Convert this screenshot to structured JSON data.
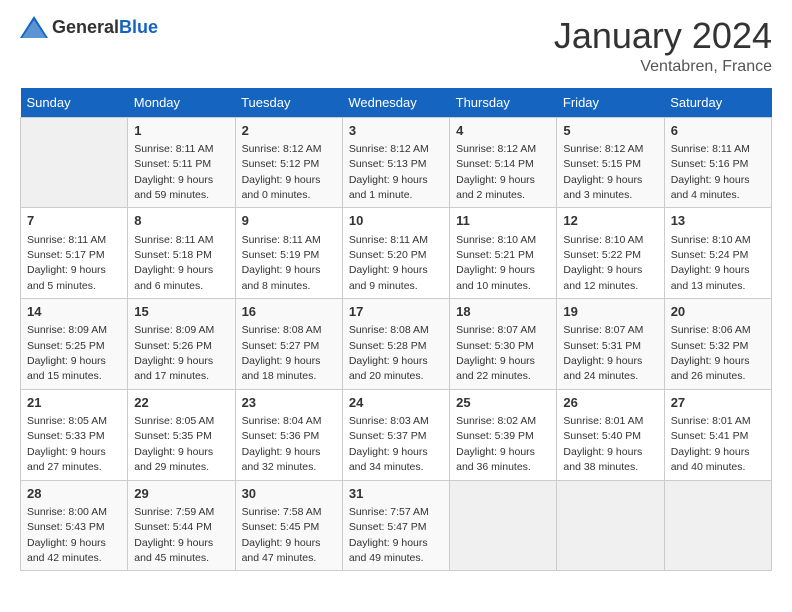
{
  "header": {
    "logo_general": "General",
    "logo_blue": "Blue",
    "title": "January 2024",
    "subtitle": "Ventabren, France"
  },
  "calendar": {
    "weekdays": [
      "Sunday",
      "Monday",
      "Tuesday",
      "Wednesday",
      "Thursday",
      "Friday",
      "Saturday"
    ],
    "weeks": [
      [
        {
          "day": "",
          "empty": true
        },
        {
          "day": "1",
          "sunrise": "Sunrise: 8:11 AM",
          "sunset": "Sunset: 5:11 PM",
          "daylight": "Daylight: 9 hours and 59 minutes."
        },
        {
          "day": "2",
          "sunrise": "Sunrise: 8:12 AM",
          "sunset": "Sunset: 5:12 PM",
          "daylight": "Daylight: 9 hours and 0 minutes."
        },
        {
          "day": "3",
          "sunrise": "Sunrise: 8:12 AM",
          "sunset": "Sunset: 5:13 PM",
          "daylight": "Daylight: 9 hours and 1 minute."
        },
        {
          "day": "4",
          "sunrise": "Sunrise: 8:12 AM",
          "sunset": "Sunset: 5:14 PM",
          "daylight": "Daylight: 9 hours and 2 minutes."
        },
        {
          "day": "5",
          "sunrise": "Sunrise: 8:12 AM",
          "sunset": "Sunset: 5:15 PM",
          "daylight": "Daylight: 9 hours and 3 minutes."
        },
        {
          "day": "6",
          "sunrise": "Sunrise: 8:11 AM",
          "sunset": "Sunset: 5:16 PM",
          "daylight": "Daylight: 9 hours and 4 minutes."
        }
      ],
      [
        {
          "day": "7",
          "sunrise": "Sunrise: 8:11 AM",
          "sunset": "Sunset: 5:17 PM",
          "daylight": "Daylight: 9 hours and 5 minutes."
        },
        {
          "day": "8",
          "sunrise": "Sunrise: 8:11 AM",
          "sunset": "Sunset: 5:18 PM",
          "daylight": "Daylight: 9 hours and 6 minutes."
        },
        {
          "day": "9",
          "sunrise": "Sunrise: 8:11 AM",
          "sunset": "Sunset: 5:19 PM",
          "daylight": "Daylight: 9 hours and 8 minutes."
        },
        {
          "day": "10",
          "sunrise": "Sunrise: 8:11 AM",
          "sunset": "Sunset: 5:20 PM",
          "daylight": "Daylight: 9 hours and 9 minutes."
        },
        {
          "day": "11",
          "sunrise": "Sunrise: 8:10 AM",
          "sunset": "Sunset: 5:21 PM",
          "daylight": "Daylight: 9 hours and 10 minutes."
        },
        {
          "day": "12",
          "sunrise": "Sunrise: 8:10 AM",
          "sunset": "Sunset: 5:22 PM",
          "daylight": "Daylight: 9 hours and 12 minutes."
        },
        {
          "day": "13",
          "sunrise": "Sunrise: 8:10 AM",
          "sunset": "Sunset: 5:24 PM",
          "daylight": "Daylight: 9 hours and 13 minutes."
        }
      ],
      [
        {
          "day": "14",
          "sunrise": "Sunrise: 8:09 AM",
          "sunset": "Sunset: 5:25 PM",
          "daylight": "Daylight: 9 hours and 15 minutes."
        },
        {
          "day": "15",
          "sunrise": "Sunrise: 8:09 AM",
          "sunset": "Sunset: 5:26 PM",
          "daylight": "Daylight: 9 hours and 17 minutes."
        },
        {
          "day": "16",
          "sunrise": "Sunrise: 8:08 AM",
          "sunset": "Sunset: 5:27 PM",
          "daylight": "Daylight: 9 hours and 18 minutes."
        },
        {
          "day": "17",
          "sunrise": "Sunrise: 8:08 AM",
          "sunset": "Sunset: 5:28 PM",
          "daylight": "Daylight: 9 hours and 20 minutes."
        },
        {
          "day": "18",
          "sunrise": "Sunrise: 8:07 AM",
          "sunset": "Sunset: 5:30 PM",
          "daylight": "Daylight: 9 hours and 22 minutes."
        },
        {
          "day": "19",
          "sunrise": "Sunrise: 8:07 AM",
          "sunset": "Sunset: 5:31 PM",
          "daylight": "Daylight: 9 hours and 24 minutes."
        },
        {
          "day": "20",
          "sunrise": "Sunrise: 8:06 AM",
          "sunset": "Sunset: 5:32 PM",
          "daylight": "Daylight: 9 hours and 26 minutes."
        }
      ],
      [
        {
          "day": "21",
          "sunrise": "Sunrise: 8:05 AM",
          "sunset": "Sunset: 5:33 PM",
          "daylight": "Daylight: 9 hours and 27 minutes."
        },
        {
          "day": "22",
          "sunrise": "Sunrise: 8:05 AM",
          "sunset": "Sunset: 5:35 PM",
          "daylight": "Daylight: 9 hours and 29 minutes."
        },
        {
          "day": "23",
          "sunrise": "Sunrise: 8:04 AM",
          "sunset": "Sunset: 5:36 PM",
          "daylight": "Daylight: 9 hours and 32 minutes."
        },
        {
          "day": "24",
          "sunrise": "Sunrise: 8:03 AM",
          "sunset": "Sunset: 5:37 PM",
          "daylight": "Daylight: 9 hours and 34 minutes."
        },
        {
          "day": "25",
          "sunrise": "Sunrise: 8:02 AM",
          "sunset": "Sunset: 5:39 PM",
          "daylight": "Daylight: 9 hours and 36 minutes."
        },
        {
          "day": "26",
          "sunrise": "Sunrise: 8:01 AM",
          "sunset": "Sunset: 5:40 PM",
          "daylight": "Daylight: 9 hours and 38 minutes."
        },
        {
          "day": "27",
          "sunrise": "Sunrise: 8:01 AM",
          "sunset": "Sunset: 5:41 PM",
          "daylight": "Daylight: 9 hours and 40 minutes."
        }
      ],
      [
        {
          "day": "28",
          "sunrise": "Sunrise: 8:00 AM",
          "sunset": "Sunset: 5:43 PM",
          "daylight": "Daylight: 9 hours and 42 minutes."
        },
        {
          "day": "29",
          "sunrise": "Sunrise: 7:59 AM",
          "sunset": "Sunset: 5:44 PM",
          "daylight": "Daylight: 9 hours and 45 minutes."
        },
        {
          "day": "30",
          "sunrise": "Sunrise: 7:58 AM",
          "sunset": "Sunset: 5:45 PM",
          "daylight": "Daylight: 9 hours and 47 minutes."
        },
        {
          "day": "31",
          "sunrise": "Sunrise: 7:57 AM",
          "sunset": "Sunset: 5:47 PM",
          "daylight": "Daylight: 9 hours and 49 minutes."
        },
        {
          "day": "",
          "empty": true
        },
        {
          "day": "",
          "empty": true
        },
        {
          "day": "",
          "empty": true
        }
      ]
    ]
  }
}
